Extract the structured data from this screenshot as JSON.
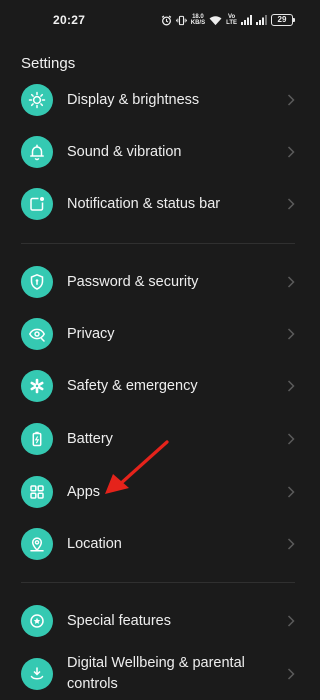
{
  "status_bar": {
    "time": "20:27",
    "speed_value": "18.0",
    "speed_unit": "KB/S",
    "volte_top": "Vo",
    "volte_bottom": "LTE",
    "battery": "29",
    "icons": [
      "alarm-icon",
      "vibrate-icon",
      "speed-icon",
      "wifi-icon",
      "volte-icon",
      "signal-icon",
      "signal-icon",
      "battery-icon"
    ]
  },
  "header": {
    "title": "Settings"
  },
  "groups": [
    {
      "items": [
        {
          "label": "Display & brightness",
          "icon": "sun-icon"
        },
        {
          "label": "Sound & vibration",
          "icon": "bell-icon"
        },
        {
          "label": "Notification & status bar",
          "icon": "notification-icon"
        }
      ]
    },
    {
      "items": [
        {
          "label": "Password & security",
          "icon": "shield-icon"
        },
        {
          "label": "Privacy",
          "icon": "eye-icon"
        },
        {
          "label": "Safety & emergency",
          "icon": "asterisk-icon"
        },
        {
          "label": "Battery",
          "icon": "battery-icon"
        },
        {
          "label": "Apps",
          "icon": "grid-icon"
        },
        {
          "label": "Location",
          "icon": "location-pin-icon"
        }
      ]
    },
    {
      "items": [
        {
          "label": "Special features",
          "icon": "star-icon"
        },
        {
          "label": "Digital Wellbeing & parental controls",
          "icon": "wellbeing-icon"
        }
      ]
    }
  ],
  "colors": {
    "background": "#1b1b1b",
    "icon_accent": "#35c9b2",
    "chevron": "#5a5a5a",
    "annotation_arrow": "#e5231b"
  }
}
